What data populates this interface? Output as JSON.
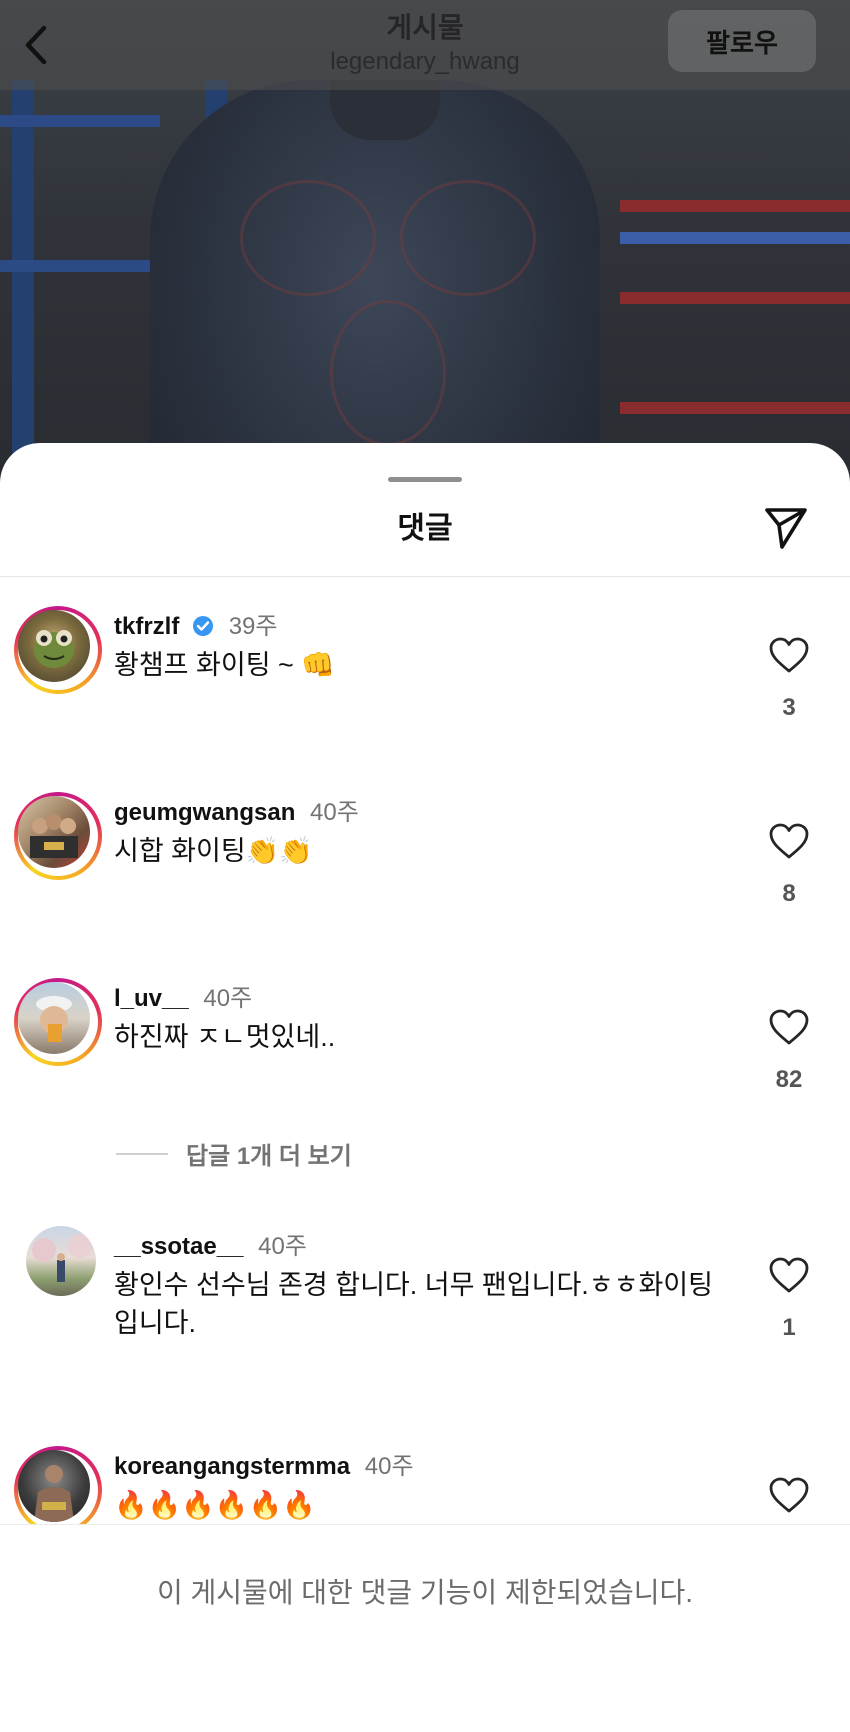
{
  "header": {
    "title": "게시물",
    "username": "legendary_hwang",
    "follow_label": "팔로우"
  },
  "sheet": {
    "title": "댓글"
  },
  "comments": [
    {
      "username": "tkfrzlf",
      "verified": true,
      "age": "39주",
      "text": "황챔프 화이팅 ~ 👊",
      "likes": "3",
      "story_ring": true
    },
    {
      "username": "geumgwangsan",
      "verified": false,
      "age": "40주",
      "text": "시합 화이팅👏👏",
      "likes": "8",
      "story_ring": true
    },
    {
      "username": "l_uv__",
      "verified": false,
      "age": "40주",
      "text": "하진짜 ㅈㄴ멋있네..",
      "likes": "82",
      "story_ring": true
    },
    {
      "username": "__ssotae__",
      "verified": false,
      "age": "40주",
      "text": "황인수 선수님 존경 합니다. 너무 팬입니다.ㅎㅎ화이팅 입니다.",
      "likes": "1",
      "story_ring": false
    },
    {
      "username": "koreangangstermma",
      "verified": false,
      "age": "40주",
      "text": "🔥🔥🔥🔥🔥🔥",
      "likes": "",
      "story_ring": true
    }
  ],
  "view_replies_label": "답글 1개 더 보기",
  "footer": {
    "notice": "이 게시물에 대한 댓글 기능이 제한되었습니다."
  },
  "icons": {
    "back": "chevron-left-icon",
    "share": "paper-plane-icon",
    "like": "heart-outline-icon",
    "verified": "verified-badge-icon"
  },
  "colors": {
    "verified_blue": "#3797f0",
    "secondary_text": "#737373"
  }
}
